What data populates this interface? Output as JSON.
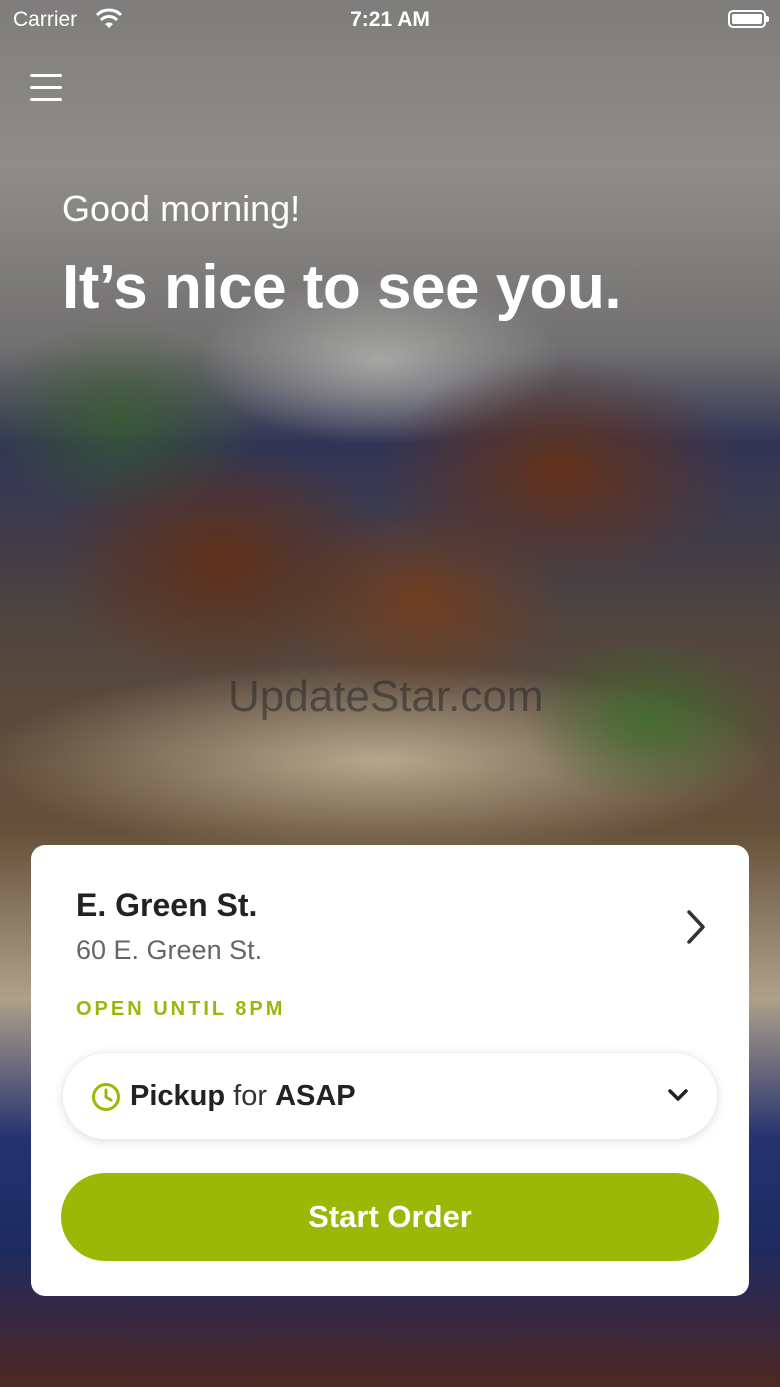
{
  "status_bar": {
    "carrier": "Carrier",
    "time": "7:21 AM"
  },
  "hero": {
    "greeting": "Good morning!",
    "headline": "It’s nice to see you.",
    "watermark": "UpdateStar.com"
  },
  "location": {
    "name": "E. Green St.",
    "address": "60 E. Green St.",
    "hours": "OPEN UNTIL 8PM"
  },
  "order_mode": {
    "method": "Pickup",
    "connector": "for",
    "time": "ASAP"
  },
  "actions": {
    "start_order": "Start Order"
  },
  "icons": {
    "menu": "hamburger-menu-icon",
    "wifi": "wifi-icon",
    "battery": "battery-icon",
    "chevron": "chevron-right-icon",
    "clock": "clock-icon",
    "dropdown": "chevron-down-icon"
  },
  "colors": {
    "accent": "#9cb806",
    "hours_text": "#9ab80a"
  }
}
